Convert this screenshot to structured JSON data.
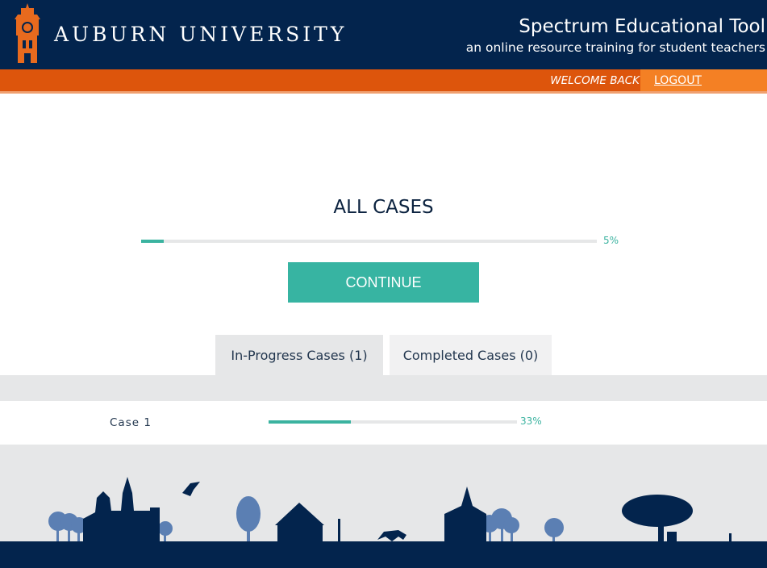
{
  "header": {
    "brand": "AUBURN UNIVERSITY",
    "app_title": "Spectrum Educational Tool",
    "app_subtitle": "an online resource training for student teachers",
    "logo_icon": "clock-tower-icon"
  },
  "userbar": {
    "welcome": "WELCOME BACK",
    "logout": "LOGOUT"
  },
  "main": {
    "title": "ALL CASES",
    "progress": {
      "value": 0.05,
      "label": "5%"
    },
    "continue_label": "CONTINUE"
  },
  "tabs": [
    {
      "label": "In-Progress Cases (1)",
      "active": true
    },
    {
      "label": "Completed Cases (0)",
      "active": false
    }
  ],
  "cases": [
    {
      "name": "Case 1",
      "progress": 0.33,
      "label": "33%"
    }
  ],
  "colors": {
    "navy": "#03244d",
    "orange": "#dd550c",
    "light_orange": "#f48024",
    "teal": "#37b4a2",
    "gray": "#e6e7e8"
  }
}
